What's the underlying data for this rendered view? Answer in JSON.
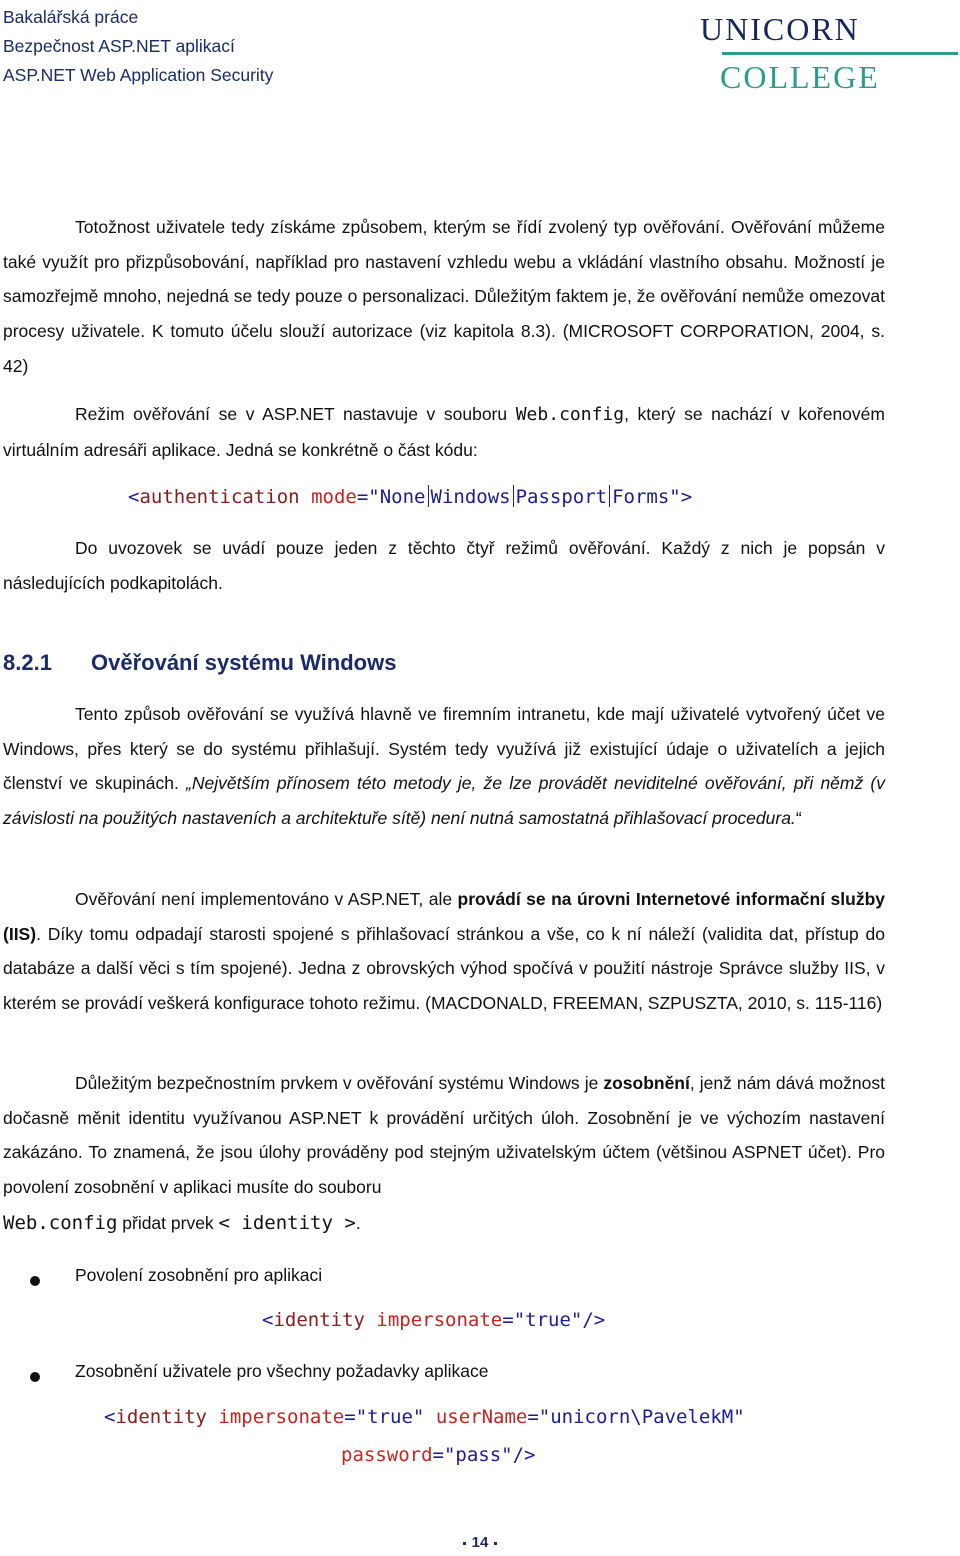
{
  "header": {
    "lines": [
      "Bakalářská práce",
      "Bezpečnost ASP.NET aplikací",
      "ASP.NET Web Application Security"
    ],
    "logo": {
      "line1": "Unicorn",
      "line2": "College",
      "color_primary": "#17275e",
      "color_secondary": "#2b9b93"
    }
  },
  "paragraphs": {
    "p1": "Totožnost uživatele tedy získáme způsobem, kterým se řídí zvolený typ ověřování. Ověřování můžeme také využít pro přizpůsobování, například pro nastavení vzhledu webu a vkládání vlastního obsahu. Možností je samozřejmě mnoho, nejedná se tedy pouze o personalizaci. Důležitým faktem je, že ověřování nemůže omezovat procesy uživatele. K tomuto účelu slouží autorizace (viz kapitola 8.3). (MICROSOFT CORPORATION, 2004, s. 42)",
    "p2": {
      "before": "Režim ověřování se v ASP.NET nastavuje v souboru ",
      "code": "Web.config",
      "after": ", který se nachází v kořenovém virtuálním adresáři aplikace. Jedná se konkrétně o část kódu:"
    },
    "code1": {
      "open": "<",
      "element": "authentication",
      "attr": "mode",
      "eq": "=",
      "q": "\"",
      "options": [
        "None",
        "Windows",
        "Passport",
        "Forms"
      ],
      "close": "\">"
    },
    "p3": "Do uvozovek se uvádí pouze jeden z těchto čtyř režimů ověřování. Každý z nich je popsán v následujících podkapitolách.",
    "heading": {
      "number": "8.2.1",
      "title": "Ověřování systému Windows"
    },
    "p4": {
      "normal": "Tento způsob ověřování se využívá hlavně ve firemním intranetu, kde mají uživatelé vytvořený účet ve Windows, přes který se do systému přihlašují. Systém tedy využívá již existující údaje o uživatelích a jejich členství ve skupinách. ",
      "quote": "„Největším přínosem této metody je, že lze provádět neviditelné ověřování, při němž (v závislosti na použitých nastaveních a architektuře sítě) není nutná samostatná přihlašovací procedura.",
      "quote_end": "“"
    },
    "p5": {
      "before": "Ověřování není implementováno v ASP.NET, ale ",
      "bold": "provádí se na úrovni Internetové informační služby (IIS)",
      "after": ". Díky tomu odpadají starosti spojené s přihlašovací stránkou a vše, co k ní náleží (validita dat, přístup do databáze a další věci s tím spojené). Jedna z obrovských výhod spočívá v použití nástroje Správce služby IIS, v kterém se provádí veškerá konfigurace tohoto režimu. (MACDONALD, FREEMAN, SZPUSZTA, 2010, s. 115-116)"
    },
    "p6": {
      "before": "Důležitým bezpečnostním prvkem v ověřování systému Windows je ",
      "bold": "zosobnění",
      "after": ", jenž nám dává možnost dočasně měnit identitu využívanou ASP.NET k provádění určitých úloh. Zosobnění je ve výchozím nastavení zakázáno. To znamená, že jsou úlohy prováděny pod stejným uživatelským účtem (většinou ASPNET účet). Pro povolení zosobnění v aplikaci musíte do souboru",
      "last_code1": "Web.config",
      "last_text": " přidat prvek ",
      "last_code2": "< identity >",
      "last_end": "."
    }
  },
  "bullets": [
    {
      "label": "Povolení zosobnění pro aplikaci",
      "code": {
        "open": "<",
        "element": "identity",
        "attr1": "impersonate",
        "val1": "\"true\"",
        "close": "/>"
      }
    },
    {
      "label": "Zosobnění uživatele pro všechny požadavky aplikace",
      "code": {
        "open": "<",
        "element": "identity",
        "attr1": "impersonate",
        "val1": "\"true\"",
        "attr2": "userName",
        "val2": "\"unicorn\\PavelekM\"",
        "attr3": "password",
        "val3": "\"pass\"",
        "close": "/>"
      }
    }
  ],
  "footer": {
    "page_number": "14"
  },
  "colors": {
    "heading": "#1b2a6b",
    "code_tag": "#1c1c9a",
    "code_element": "#8b1a1a",
    "code_attr": "#d01f1f"
  }
}
